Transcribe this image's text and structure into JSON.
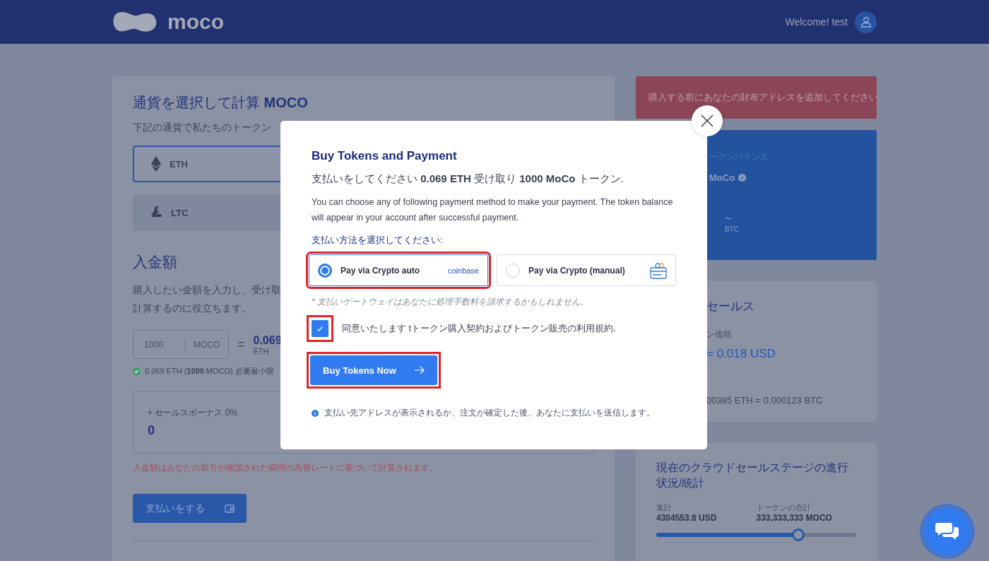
{
  "header": {
    "logo": "moco",
    "welcome": "Welcome! test"
  },
  "calculator": {
    "title": "通貨を選択して計算 **MOCO**",
    "subtitle": "下記の通貨で私たちのトークン",
    "currencies": [
      {
        "code": "ETH",
        "kind": "eth",
        "selected": true
      },
      {
        "code": "LTC",
        "kind": "ltc",
        "selected": false
      }
    ],
    "amount_title": "入金額",
    "amount_desc": [
      "購入したい金額を入力し、受け取",
      "計算するのに役立ちます。"
    ],
    "amount_input": {
      "value": "1000",
      "unit": "MOCO"
    },
    "equals": "=",
    "result": {
      "value": "0.069",
      "unit": "ETH"
    },
    "note": "0.069 ETH (**1000** MOCO) 必要最小限",
    "bonus": {
      "label": "+ セールスボーナス 0%",
      "value": "0"
    },
    "warning": "入金額はあなたの取引が確認された瞬間の為替レートに基づいて計算されます。",
    "pay_button": "支払いをする"
  },
  "sidebar": {
    "alert": "購入する前にあなたの財布アドレスを追加してください",
    "balance": {
      "label": "ークンバランス",
      "unit": "MoCo",
      "approx": "~",
      "approx_unit": "BTC"
    },
    "sale": {
      "title": "セールス",
      "price_label": "ン価格",
      "price": "= 0.018 USD",
      "rate": "00385 ETH = 0.000123 BTC"
    },
    "progress": {
      "title": "現在のクラウドセールステージの進行状況/統計",
      "raised_label": "集計",
      "raised": "4304553.8 USD",
      "total_label": "トークンの合計",
      "total": "333,333,333 MOCO",
      "level": 0.71
    }
  },
  "modal": {
    "title": "Buy Tokens and Payment",
    "summary": "支払いをしてください **0.069 ETH** 受け取り **1000 MoCo** トークン.",
    "description": "You can choose any of following payment method to make your payment. The token balance will appear in your account after successful payment.",
    "method_heading": "支払い方法を選択してください:",
    "methods": [
      {
        "label": "Pay via Crypto auto",
        "kind": "coinbase",
        "brand": "coinbase",
        "selected": true,
        "highlighted": true
      },
      {
        "label": "Pay via Crypto (manual)",
        "kind": "wallet",
        "selected": false,
        "highlighted": false
      }
    ],
    "fee_note": "* 支払いゲートウェイはあなたに処理手数料を請求するかもしれません。",
    "agreement": {
      "checked": true,
      "highlighted": true,
      "text": "同意いたします tトークン購入契約およびトークン販売の利用規約."
    },
    "buy_button": {
      "label": "Buy Tokens Now",
      "highlighted": true
    },
    "info": "支払い先アドレスが表示されるか、注文が確定した後、あなたに支払いを送信します。"
  }
}
